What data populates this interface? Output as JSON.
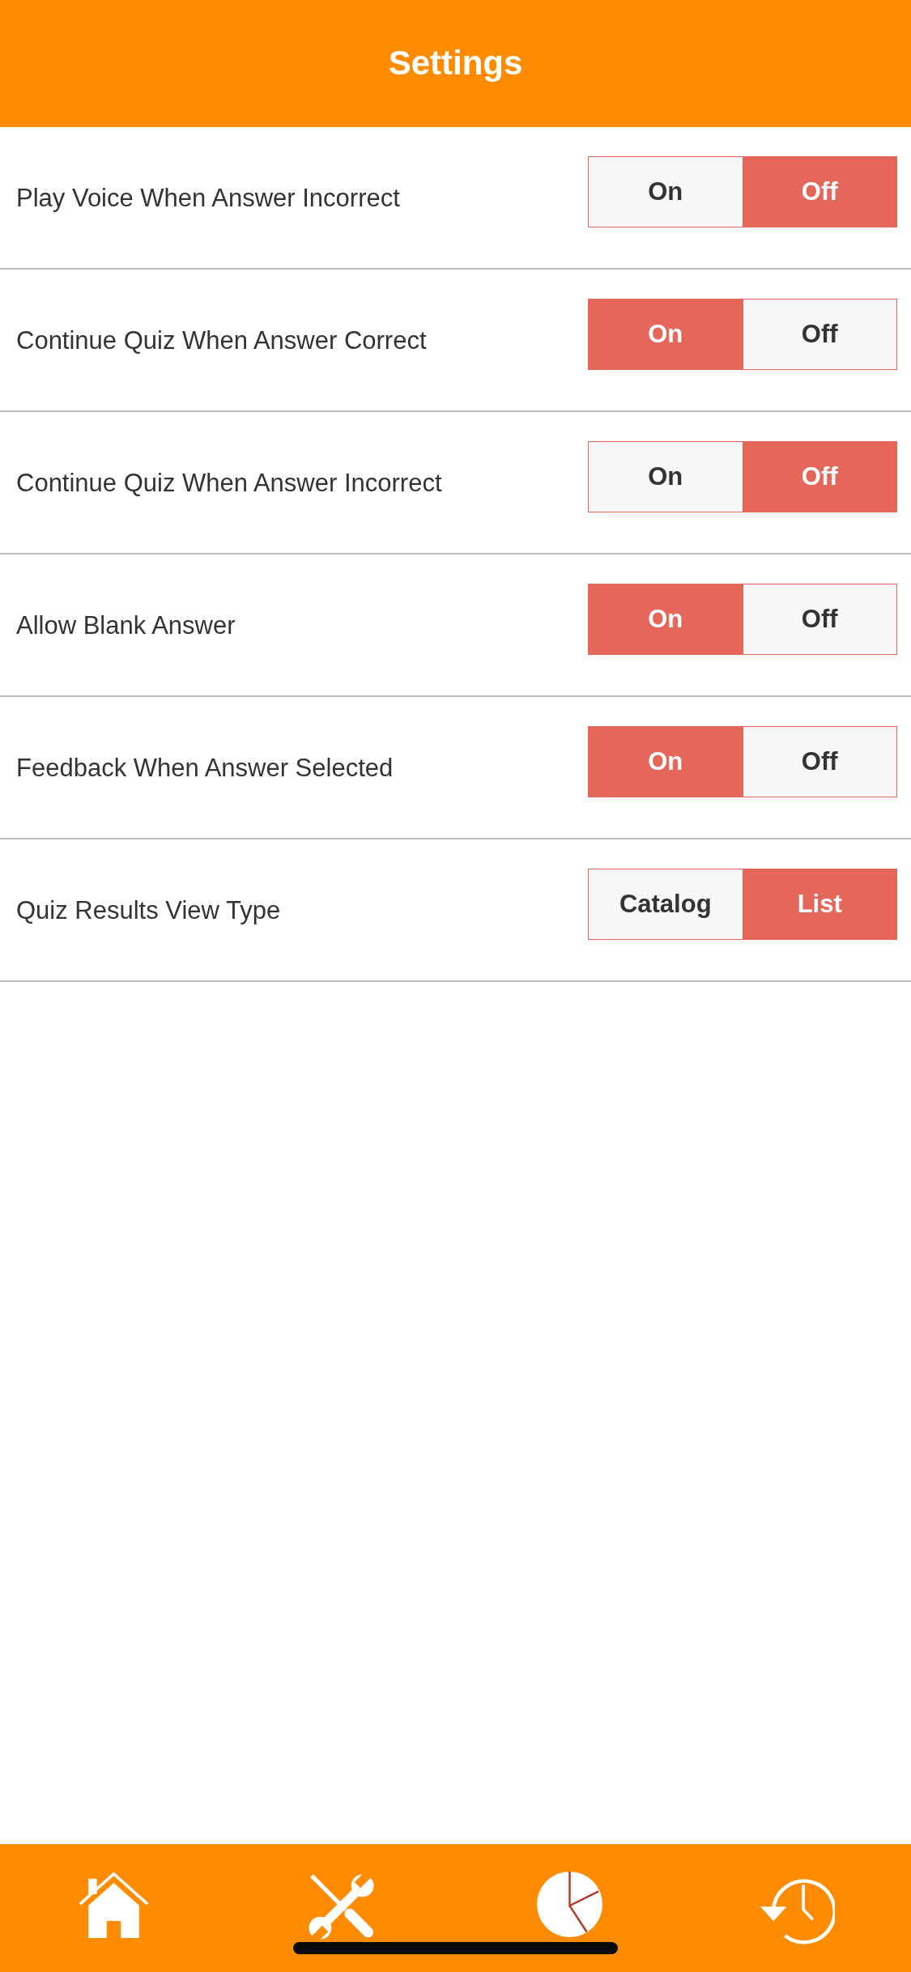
{
  "header": {
    "title": "Settings"
  },
  "settings": [
    {
      "label": "Play Voice When Answer Incorrect",
      "options": [
        {
          "label": "On",
          "selected": false
        },
        {
          "label": "Off",
          "selected": true
        }
      ]
    },
    {
      "label": "Continue Quiz When Answer Correct",
      "options": [
        {
          "label": "On",
          "selected": true
        },
        {
          "label": "Off",
          "selected": false
        }
      ]
    },
    {
      "label": "Continue Quiz When Answer Incorrect",
      "options": [
        {
          "label": "On",
          "selected": false
        },
        {
          "label": "Off",
          "selected": true
        }
      ]
    },
    {
      "label": "Allow Blank Answer",
      "options": [
        {
          "label": "On",
          "selected": true
        },
        {
          "label": "Off",
          "selected": false
        }
      ]
    },
    {
      "label": "Feedback When Answer Selected",
      "options": [
        {
          "label": "On",
          "selected": true
        },
        {
          "label": "Off",
          "selected": false
        }
      ]
    },
    {
      "label": "Quiz Results View Type",
      "options": [
        {
          "label": "Catalog",
          "selected": false
        },
        {
          "label": "List",
          "selected": true
        }
      ]
    }
  ],
  "tab_bar": {
    "items": [
      {
        "kind": "home"
      },
      {
        "kind": "tools"
      },
      {
        "kind": "chart"
      },
      {
        "kind": "history"
      }
    ]
  }
}
